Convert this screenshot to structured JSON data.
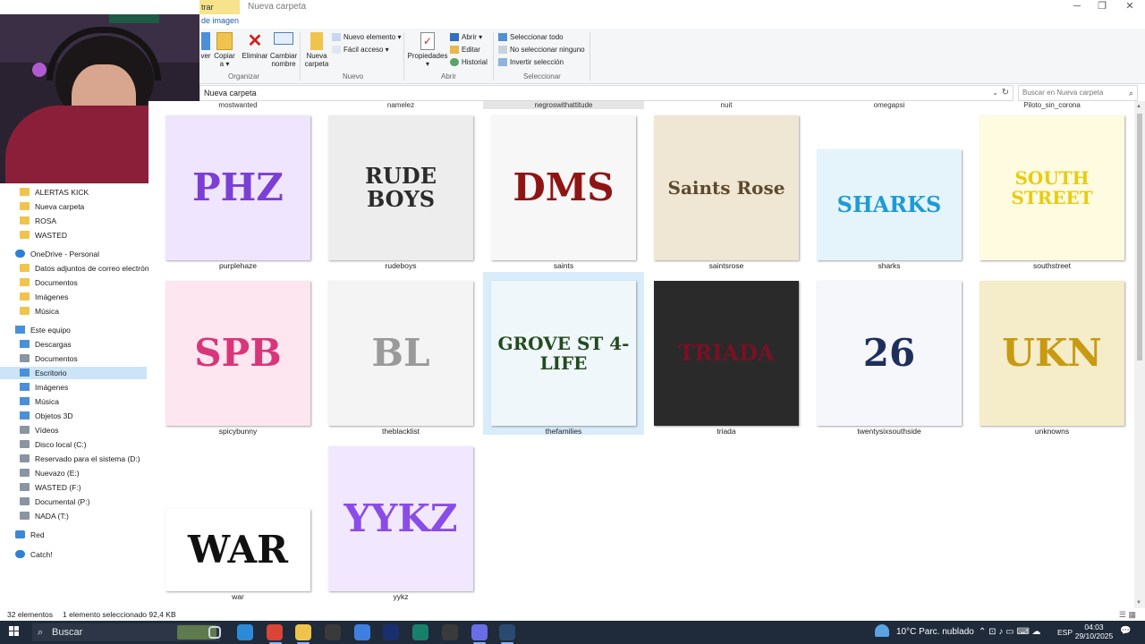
{
  "window": {
    "context_tab": "trar",
    "title": "Nueva carpeta",
    "ribbon_tab": "de imagen",
    "minimize": "─",
    "maximize": "❐",
    "close": "✕"
  },
  "ribbon": {
    "groups": {
      "organize": "Organizar",
      "new": "Nuevo",
      "open": "Abrir",
      "select": "Seleccionar"
    },
    "buttons": {
      "move": "ver",
      "copy": "Copiar",
      "copy_sub": "a ▾",
      "delete": "Eliminar",
      "rename": "Cambiar nombre",
      "new_folder": "Nueva carpeta",
      "new_item": "Nuevo elemento ▾",
      "easy_access": "Fácil acceso ▾",
      "properties": "Propiedades",
      "properties_sub": "▾",
      "open": "Abrir ▾",
      "edit": "Editar",
      "history": "Historial",
      "select_all": "Seleccionar todo",
      "select_none": "No seleccionar ninguno",
      "invert_selection": "Invertir selección"
    }
  },
  "address": {
    "path": "Nueva carpeta",
    "caret": "⌄",
    "refresh": "↻",
    "search_placeholder": "Buscar en Nueva carpeta",
    "search_icon": "⌕"
  },
  "nav": {
    "items": [
      {
        "label": "ALERTAS KICK",
        "icon": "folder-icon"
      },
      {
        "label": "Nueva carpeta",
        "icon": "folder-icon"
      },
      {
        "label": "ROSA",
        "icon": "folder-icon"
      },
      {
        "label": "WASTED",
        "icon": "folder-icon"
      },
      {
        "label": "OneDrive - Personal",
        "icon": "cloud-icon"
      },
      {
        "label": "Datos adjuntos de correo electrónico",
        "icon": "folder-icon"
      },
      {
        "label": "Documentos",
        "icon": "folder-icon"
      },
      {
        "label": "Imágenes",
        "icon": "folder-icon"
      },
      {
        "label": "Música",
        "icon": "folder-icon"
      },
      {
        "label": "Este equipo",
        "icon": "computer-icon"
      },
      {
        "label": "Descargas",
        "icon": "download-icon"
      },
      {
        "label": "Documentos",
        "icon": "document-icon"
      },
      {
        "label": "Escritorio",
        "icon": "desktop-icon"
      },
      {
        "label": "Imágenes",
        "icon": "pictures-icon"
      },
      {
        "label": "Música",
        "icon": "music-icon"
      },
      {
        "label": "Objetos 3D",
        "icon": "cube-icon"
      },
      {
        "label": "Vídeos",
        "icon": "video-icon"
      },
      {
        "label": "Disco local (C:)",
        "icon": "drive-icon"
      },
      {
        "label": "Reservado para el sistema (D:)",
        "icon": "drive-icon"
      },
      {
        "label": "Nuevazo (E:)",
        "icon": "drive-icon"
      },
      {
        "label": "WASTED (F:)",
        "icon": "drive-icon"
      },
      {
        "label": "Documental (P:)",
        "icon": "drive-icon"
      },
      {
        "label": "NADA (T:)",
        "icon": "drive-icon"
      },
      {
        "label": "Red",
        "icon": "network-icon"
      },
      {
        "label": "Catch!",
        "icon": "catch-icon"
      }
    ]
  },
  "header_row": [
    "mostwanted",
    "namelez",
    "negroswithattitude",
    "nuit",
    "omegapsi",
    "Piloto_sin_corona"
  ],
  "files": [
    {
      "name": "purplehaze",
      "text": "PHZ",
      "color": "#7b3fd6",
      "bg": "#efe5ff"
    },
    {
      "name": "rudeboys",
      "text": "RUDE BOYS",
      "color": "#2b2b2b",
      "bg": "#ededed"
    },
    {
      "name": "saints",
      "text": "DMS",
      "color": "#8f1515",
      "bg": "#f7f7f7"
    },
    {
      "name": "saintsrose",
      "text": "Saints Rose",
      "color": "#5e4a2e",
      "bg": "#efe6d4"
    },
    {
      "name": "sharks",
      "text": "SHARKS",
      "color": "#1e9ad6",
      "bg": "#e5f4fb"
    },
    {
      "name": "southstreet",
      "text": "SOUTH STREET",
      "color": "#e8cc12",
      "bg": "#fffbe0"
    },
    {
      "name": "spicybunny",
      "text": "SPB",
      "color": "#d9367a",
      "bg": "#fde6ef"
    },
    {
      "name": "theblacklist",
      "text": "BL",
      "color": "#9a9a9a",
      "bg": "#f4f4f4"
    },
    {
      "name": "thefamilies",
      "text": "GROVE ST 4-LIFE",
      "color": "#234a1d",
      "bg": "#eff7fb"
    },
    {
      "name": "triada",
      "text": "TRIADA",
      "color": "#7a1024",
      "bg": "#2a2a2a"
    },
    {
      "name": "twentysixsouthside",
      "text": "26",
      "color": "#1f2f5c",
      "bg": "#f5f7fb"
    },
    {
      "name": "unknowns",
      "text": "UKN",
      "color": "#c79a12",
      "bg": "#f5ecc9"
    },
    {
      "name": "war",
      "text": "WAR",
      "color": "#111111",
      "bg": "#ffffff"
    },
    {
      "name": "yykz",
      "text": "YYKZ",
      "color": "#8a4ce8",
      "bg": "#f1e8ff"
    }
  ],
  "status": {
    "count": "32 elementos",
    "selection": "1 elemento seleccionado  92,4 KB",
    "view_icons": "☰ ▦"
  },
  "taskbar": {
    "search": "Buscar",
    "search_icon": "⌕",
    "weather": "10°C  Parc. nublado",
    "tray": "⌃  ⊡  ♪  ▭  ⌨  ☁",
    "lang": "ESP",
    "time": "04:03",
    "date": "29/10/2025",
    "notif": "💬",
    "apps": [
      {
        "name": "task-view",
        "color": "#cfd8e3"
      },
      {
        "name": "edge",
        "color": "#2b8bd8"
      },
      {
        "name": "chrome",
        "color": "#db4437"
      },
      {
        "name": "file-explorer",
        "color": "#f0c44c"
      },
      {
        "name": "obs",
        "color": "#3a3a3a"
      },
      {
        "name": "app-blue",
        "color": "#3f7fe0"
      },
      {
        "name": "photoshop",
        "color": "#1a2f6e"
      },
      {
        "name": "app-v",
        "color": "#17806b"
      },
      {
        "name": "app-c",
        "color": "#3a3a3a"
      },
      {
        "name": "discord",
        "color": "#6a6ee6"
      },
      {
        "name": "steam",
        "color": "#2a4a72"
      }
    ]
  }
}
